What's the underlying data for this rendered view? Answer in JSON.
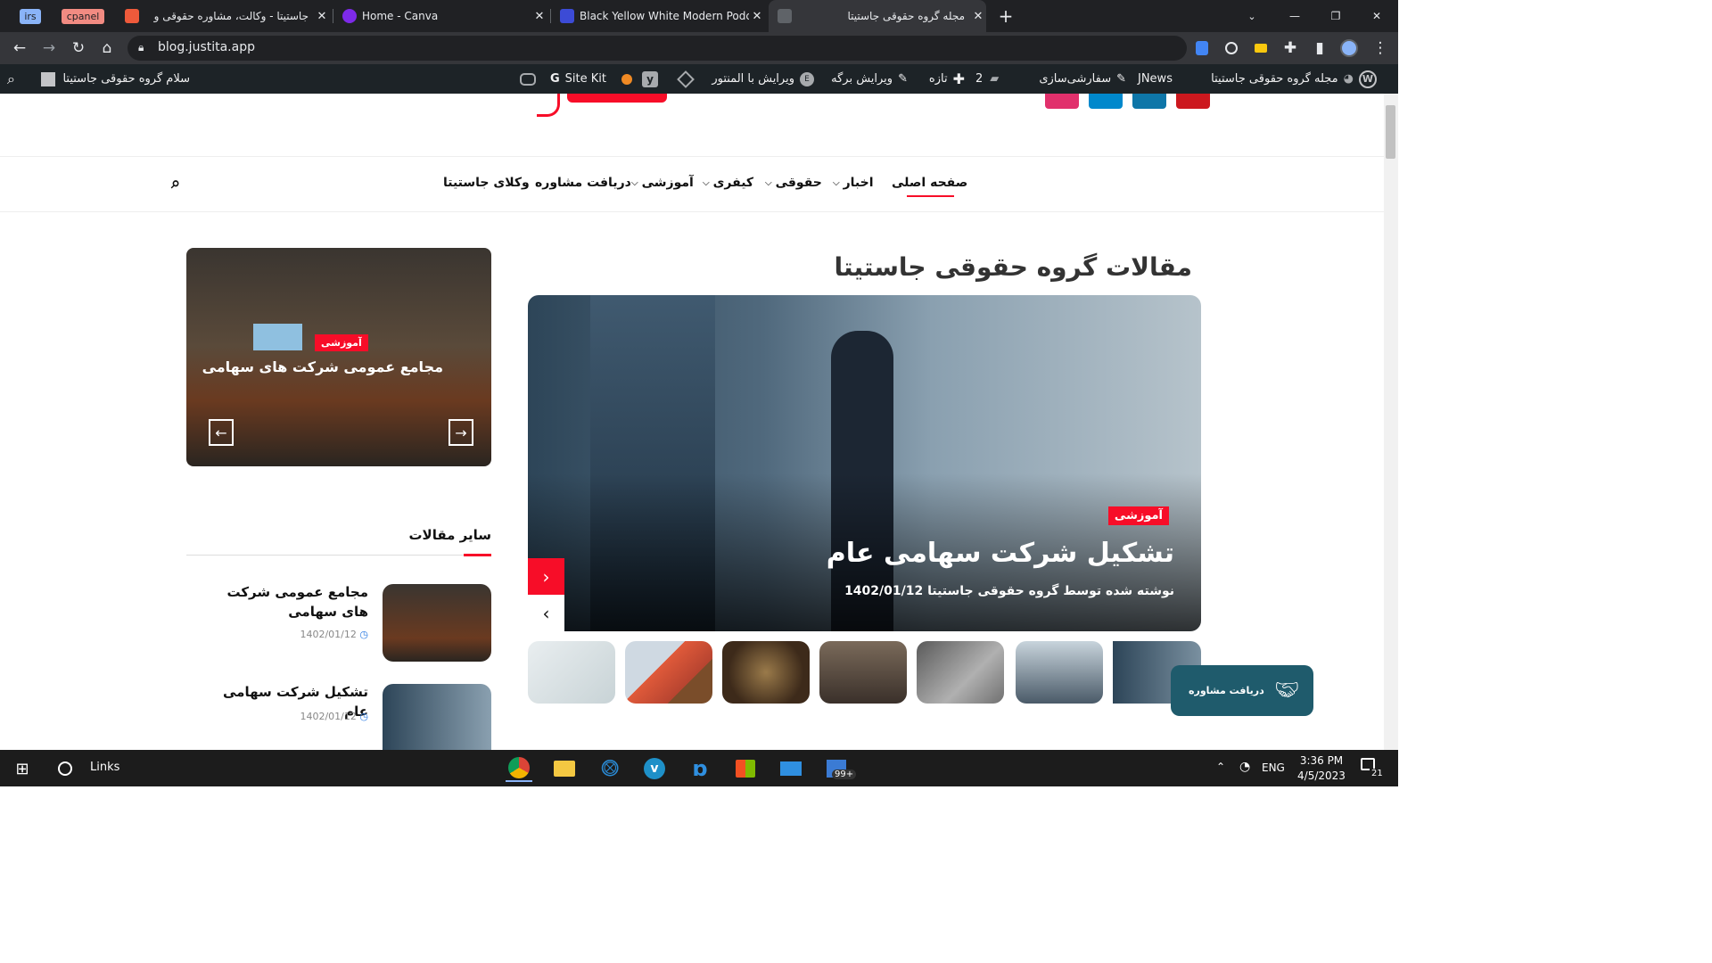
{
  "browser": {
    "tabs": [
      {
        "label": "irs",
        "kind": "pinned"
      },
      {
        "label": "cpanel",
        "kind": "pinned"
      },
      {
        "title": "جاستیتا - وکالت، مشاوره حقوقی و"
      },
      {
        "title": "Home - Canva"
      },
      {
        "title": "Black Yellow White Modern Podc"
      },
      {
        "title": "مجله گروه حقوقی جاستیتا",
        "active": true
      }
    ],
    "new_tab": "+",
    "address": "blog.justita.app"
  },
  "wp_admin_bar": {
    "site_name": "مجله گروه حقوقی جاستیتا",
    "jnews": "JNews",
    "customize": "سفارشی‌سازی",
    "comments_count": "2",
    "new": "تازه",
    "edit_page": "ویرایش برگه",
    "edit_with_elementor": "ویرایش با المنتور",
    "site_kit": "Site Kit",
    "greeting": "سلام گروه حقوقی جاستیتا"
  },
  "site": {
    "nav": [
      {
        "label": "صفحه اصلی",
        "active": true
      },
      {
        "label": "اخبار",
        "has_dropdown": true
      },
      {
        "label": "حقوقی",
        "has_dropdown": true
      },
      {
        "label": "کیفری",
        "has_dropdown": true
      },
      {
        "label": "آموزشی",
        "has_dropdown": true
      },
      {
        "label": "دریافت مشاوره"
      },
      {
        "label": "وکلای جاستیتا"
      }
    ],
    "page_heading": "مقالات گروه حقوقی جاستیتا",
    "hero": {
      "category": "آموزشی",
      "title": "تشکیل شرکت سهامی عام",
      "meta": "نوشته شده توسط گروه حقوقی جاستیتا  1402/01/12"
    },
    "side_slider": {
      "category": "آموزشی",
      "title": "مجامع عمومی شرکت های سهامی"
    },
    "other_articles": {
      "heading": "سایر مقالات",
      "items": [
        {
          "title": "مجامع عمومی شرکت های سهامی",
          "date": "1402/01/12"
        },
        {
          "title": "تشکیل شرکت سهامی عام",
          "date": "1402/01/12"
        }
      ]
    },
    "consult_button": "دریافت مشاوره"
  },
  "taskbar": {
    "search_label": "Links",
    "lang": "ENG",
    "time": "3:36 PM",
    "date": "4/5/2023",
    "notif_count": "21",
    "badge": "99+"
  },
  "colors": {
    "accent_red": "#f70d28",
    "teal_button": "#1f5b6c"
  }
}
